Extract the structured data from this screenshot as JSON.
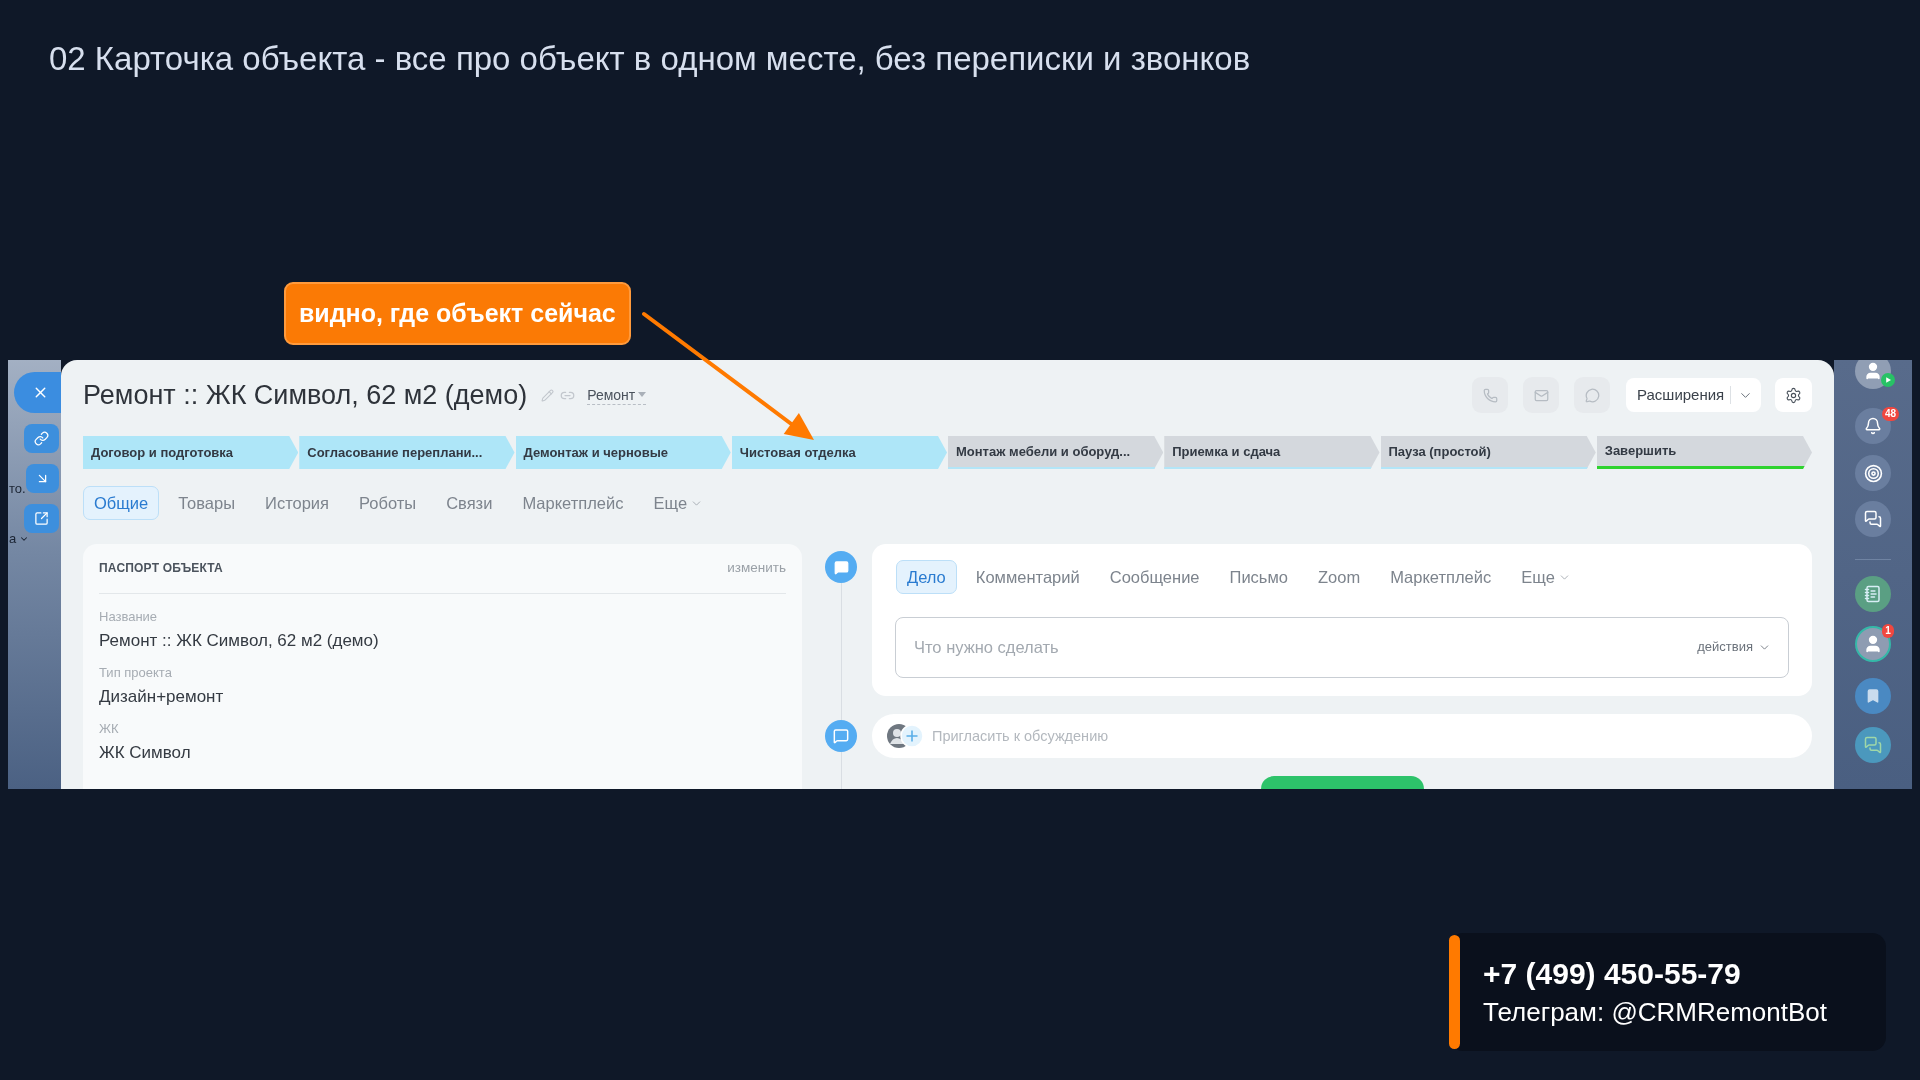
{
  "slide": {
    "title": "02 Карточка объекта - все про объект в одном месте, без переписки и звонков"
  },
  "callout": {
    "text": "видно, где объект сейчас"
  },
  "crm_card": {
    "left_strip": {
      "fragments": [
        {
          "text": "то.",
          "dropdown": false
        },
        {
          "text": "а",
          "dropdown": true
        }
      ]
    },
    "header": {
      "title": "Ремонт :: ЖК Символ, 62 м2 (демо)",
      "category": "Ремонт",
      "extensions_button": "Расширения"
    },
    "stages": [
      {
        "label": "Договор и подготовка",
        "reached": true,
        "kind": "stage"
      },
      {
        "label": "Согласование переплани...",
        "reached": true,
        "kind": "stage"
      },
      {
        "label": "Демонтаж и черновые",
        "reached": true,
        "kind": "stage"
      },
      {
        "label": "Чистовая отделка",
        "reached": true,
        "kind": "stage"
      },
      {
        "label": "Монтаж мебели и оборуд...",
        "reached": false,
        "kind": "stage"
      },
      {
        "label": "Приемка и сдача",
        "reached": false,
        "kind": "stage"
      },
      {
        "label": "Пауза (простой)",
        "reached": false,
        "kind": "stage"
      },
      {
        "label": "Завершить",
        "reached": false,
        "kind": "finish"
      }
    ],
    "tabs": [
      {
        "label": "Общие",
        "selected": true,
        "kind": "tab"
      },
      {
        "label": "Товары",
        "selected": false,
        "kind": "tab"
      },
      {
        "label": "История",
        "selected": false,
        "kind": "tab"
      },
      {
        "label": "Роботы",
        "selected": false,
        "kind": "tab"
      },
      {
        "label": "Связи",
        "selected": false,
        "kind": "tab"
      },
      {
        "label": "Маркетплейс",
        "selected": false,
        "kind": "tab"
      },
      {
        "label": "Еще",
        "selected": false,
        "kind": "menu"
      }
    ],
    "passport": {
      "title": "ПАСПОРТ ОБЪЕКТА",
      "edit_link": "изменить",
      "fields": [
        {
          "label": "Название",
          "value": "Ремонт :: ЖК Символ, 62 м2 (демо)"
        },
        {
          "label": "Тип проекта",
          "value": "Дизайн+ремонт"
        },
        {
          "label": "ЖК",
          "value": "ЖК Символ"
        }
      ]
    },
    "activity": {
      "tabs": [
        {
          "label": "Дело",
          "selected": true,
          "kind": "tab"
        },
        {
          "label": "Комментарий",
          "selected": false,
          "kind": "tab"
        },
        {
          "label": "Сообщение",
          "selected": false,
          "kind": "tab"
        },
        {
          "label": "Письмо",
          "selected": false,
          "kind": "tab"
        },
        {
          "label": "Zoom",
          "selected": false,
          "kind": "tab"
        },
        {
          "label": "Маркетплейс",
          "selected": false,
          "kind": "tab"
        },
        {
          "label": "Еще",
          "selected": false,
          "kind": "menu"
        }
      ],
      "task_input": {
        "placeholder": "Что нужно сделать"
      },
      "actions_menu": "действия"
    },
    "invite": {
      "placeholder": "Пригласить к обсуждению"
    },
    "right_sidebar": {
      "notifications_count": "48",
      "chat_count": "1"
    }
  },
  "contact": {
    "phone": "+7 (499) 450-55-79",
    "telegram": "Телеграм: @CRMRemontBot"
  }
}
